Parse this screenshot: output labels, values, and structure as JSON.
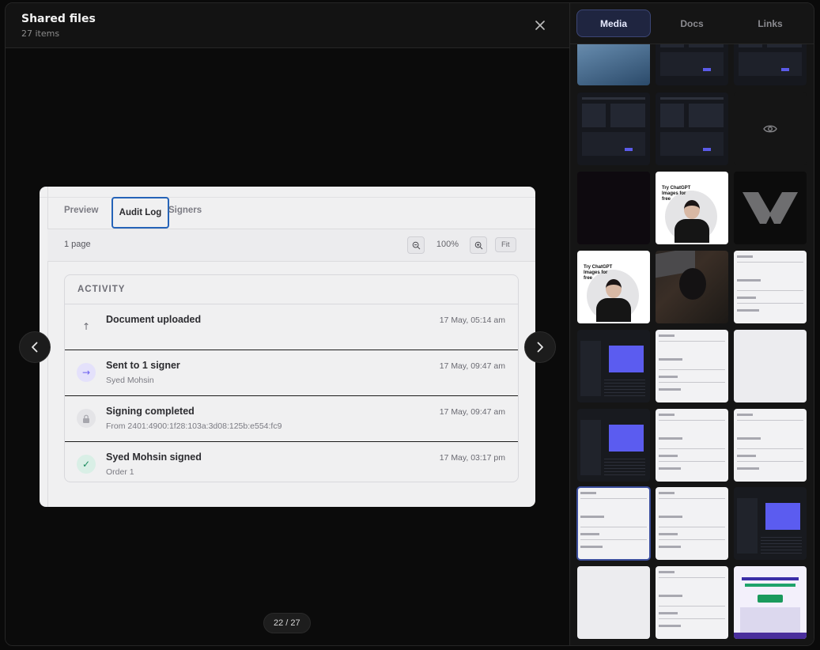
{
  "header": {
    "title": "Shared files",
    "subtitle": "27 items"
  },
  "viewer": {
    "tabs": [
      {
        "label": "Preview",
        "active": false
      },
      {
        "label": "Audit Log",
        "active": true
      },
      {
        "label": "Signers",
        "active": false
      }
    ],
    "toolbar": {
      "pages": "1 page",
      "zoom": "100%",
      "fit_label": "Fit"
    },
    "activity": {
      "heading": "ACTIVITY",
      "events": [
        {
          "title": "Document uploaded",
          "sub": "",
          "time": "17 May, 05:14 am",
          "icon": "upload-arrow-icon"
        },
        {
          "title": "Sent to 1 signer",
          "sub": "Syed Mohsin",
          "time": "17 May, 09:47 am",
          "icon": "send-arrow-icon"
        },
        {
          "title": "Signing completed",
          "sub": "From 2401:4900:1f28:103a:3d08:125b:e554:fc9",
          "time": "17 May, 09:47 am",
          "icon": "lock-icon"
        },
        {
          "title": "Syed Mohsin signed",
          "sub": "Order 1",
          "time": "17 May, 03:17 pm",
          "icon": "check-icon"
        }
      ]
    },
    "counter": "22 / 27"
  },
  "panel": {
    "tabs": [
      {
        "label": "Media",
        "active": true
      },
      {
        "label": "Docs",
        "active": false
      },
      {
        "label": "Links",
        "active": false
      }
    ],
    "thumb_caption": "Try ChatGPT Images for free"
  },
  "colors": {
    "accent": "#3c4675",
    "focus": "#2563b8",
    "background": "#111111"
  }
}
